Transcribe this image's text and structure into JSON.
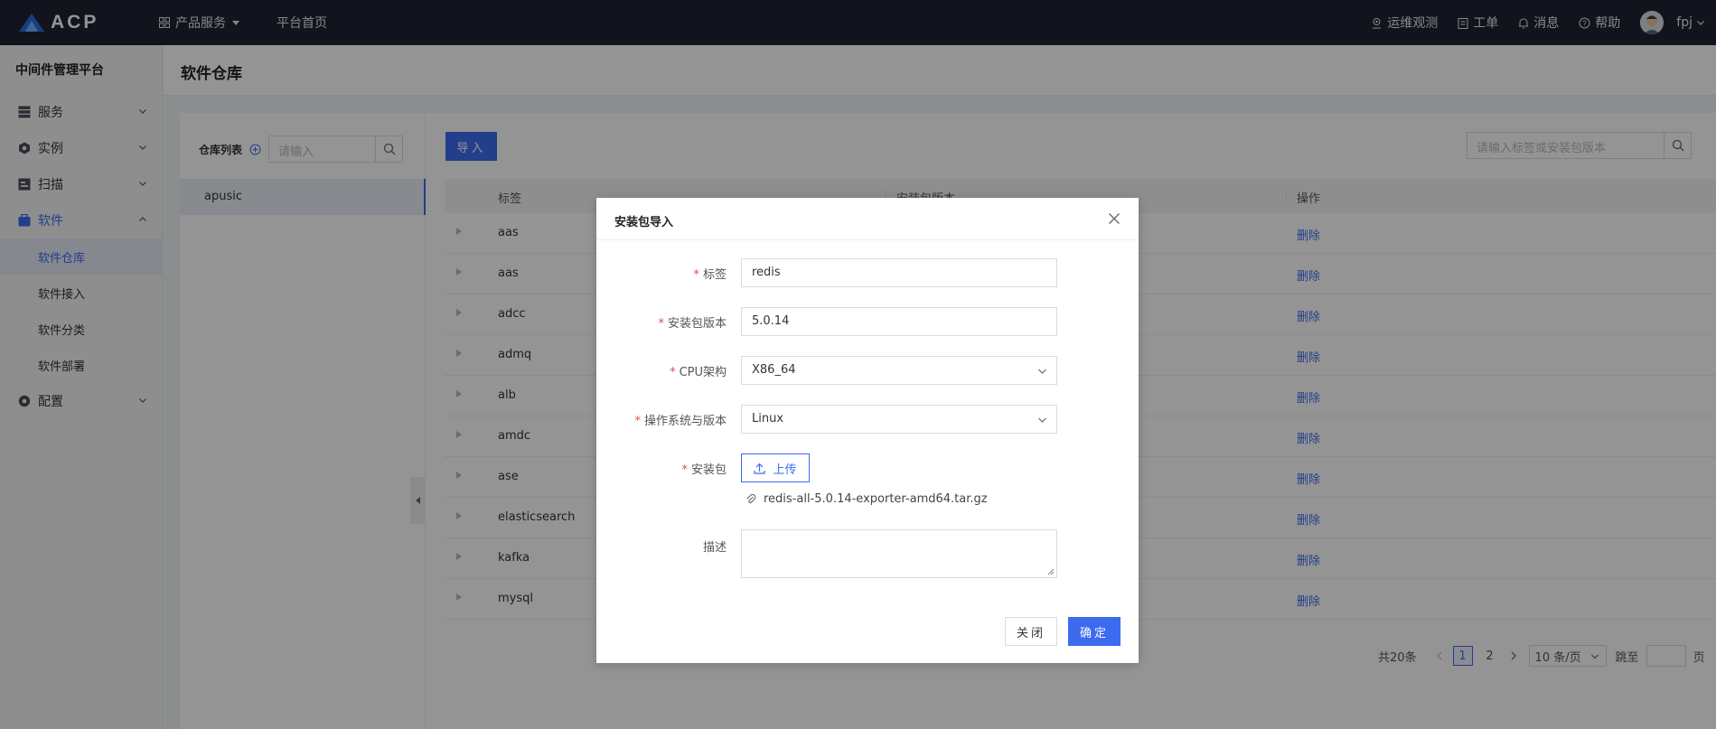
{
  "brand": {
    "name": "ACP"
  },
  "topnav": {
    "products": "产品服务",
    "home": "平台首页"
  },
  "topright": {
    "ops": "运维观测",
    "tickets": "工单",
    "messages": "消息",
    "help": "帮助",
    "user": "fpj"
  },
  "sidebar": {
    "title": "中间件管理平台",
    "items": [
      {
        "label": "服务",
        "icon": "server-icon"
      },
      {
        "label": "实例",
        "icon": "instance-icon"
      },
      {
        "label": "扫描",
        "icon": "scan-icon"
      },
      {
        "label": "软件",
        "icon": "software-icon",
        "expanded": true
      },
      {
        "label": "配置",
        "icon": "config-icon"
      }
    ],
    "subitems": [
      "软件仓库",
      "软件接入",
      "软件分类",
      "软件部署"
    ]
  },
  "page": {
    "title": "软件仓库"
  },
  "repo": {
    "label": "仓库列表",
    "placeholder": "请输入",
    "selected": "apusic"
  },
  "toolbar": {
    "import_label": "导入",
    "search_placeholder": "请输入标签或安装包版本"
  },
  "table": {
    "headers": [
      "标签",
      "安装包版本",
      "操作"
    ],
    "rows": [
      "aas",
      "aas",
      "adcc",
      "admq",
      "alb",
      "amdc",
      "ase",
      "elasticsearch",
      "kafka",
      "mysql"
    ],
    "action": "删除"
  },
  "pager": {
    "total": "共20条",
    "pages": [
      "1",
      "2"
    ],
    "current": "1",
    "size": "10 条/页",
    "jump": "跳至",
    "page_suffix": "页"
  },
  "modal": {
    "title": "安装包导入",
    "fields": {
      "tag_label": "标签",
      "tag_value": "redis",
      "version_label": "安装包版本",
      "version_value": "5.0.14",
      "cpu_label": "CPU架构",
      "cpu_value": "X86_64",
      "os_label": "操作系统与版本",
      "os_value": "Linux",
      "package_label": "安装包",
      "upload_label": "上传",
      "file_name": "redis-all-5.0.14-exporter-amd64.tar.gz",
      "desc_label": "描述"
    },
    "close_label": "关闭",
    "ok_label": "确定"
  },
  "colors": {
    "primary": "#3d6bf0",
    "topbar": "#1e2333",
    "required": "#e04d4d"
  }
}
